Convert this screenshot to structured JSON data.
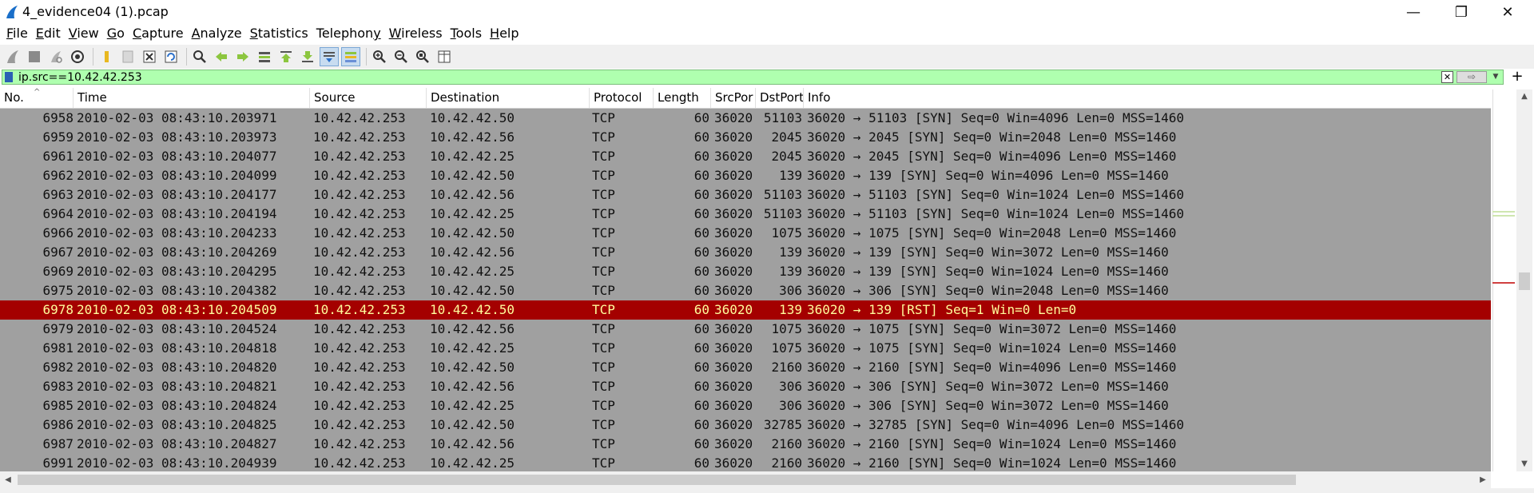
{
  "window": {
    "title": "4_evidence04 (1).pcap",
    "minimize": "—",
    "restore": "❐",
    "close": "✕"
  },
  "menu": [
    {
      "ul": "F",
      "rest": "ile"
    },
    {
      "ul": "E",
      "rest": "dit"
    },
    {
      "ul": "V",
      "rest": "iew"
    },
    {
      "ul": "G",
      "rest": "o"
    },
    {
      "ul": "C",
      "rest": "apture"
    },
    {
      "ul": "A",
      "rest": "nalyze"
    },
    {
      "ul": "S",
      "rest": "tatistics"
    },
    {
      "ul": "",
      "rest": "Telephon",
      "ul2": "y"
    },
    {
      "ul": "W",
      "rest": "ireless"
    },
    {
      "ul": "T",
      "rest": "ools"
    },
    {
      "ul": "H",
      "rest": "elp"
    }
  ],
  "filter": {
    "value": "ip.src==10.42.42.253",
    "clear": "✕",
    "apply": "⇨",
    "dropdown": "▼",
    "add": "+"
  },
  "columns": {
    "no": "No.",
    "time": "Time",
    "source": "Source",
    "destination": "Destination",
    "protocol": "Protocol",
    "length": "Length",
    "srcport": "SrcPor",
    "dstport": "DstPort",
    "info": "Info"
  },
  "packets": [
    {
      "no": "6958",
      "time": "2010-02-03 08:43:10.203971",
      "src": "10.42.42.253",
      "dst": "10.42.42.50",
      "proto": "TCP",
      "len": "60",
      "sport": "36020",
      "dport": "51103",
      "info": "36020 → 51103 [SYN] Seq=0 Win=4096 Len=0 MSS=1460"
    },
    {
      "no": "6959",
      "time": "2010-02-03 08:43:10.203973",
      "src": "10.42.42.253",
      "dst": "10.42.42.56",
      "proto": "TCP",
      "len": "60",
      "sport": "36020",
      "dport": "2045",
      "info": "36020 → 2045 [SYN] Seq=0 Win=2048 Len=0 MSS=1460"
    },
    {
      "no": "6961",
      "time": "2010-02-03 08:43:10.204077",
      "src": "10.42.42.253",
      "dst": "10.42.42.25",
      "proto": "TCP",
      "len": "60",
      "sport": "36020",
      "dport": "2045",
      "info": "36020 → 2045 [SYN] Seq=0 Win=4096 Len=0 MSS=1460"
    },
    {
      "no": "6962",
      "time": "2010-02-03 08:43:10.204099",
      "src": "10.42.42.253",
      "dst": "10.42.42.50",
      "proto": "TCP",
      "len": "60",
      "sport": "36020",
      "dport": "139",
      "info": "36020 → 139 [SYN] Seq=0 Win=4096 Len=0 MSS=1460"
    },
    {
      "no": "6963",
      "time": "2010-02-03 08:43:10.204177",
      "src": "10.42.42.253",
      "dst": "10.42.42.56",
      "proto": "TCP",
      "len": "60",
      "sport": "36020",
      "dport": "51103",
      "info": "36020 → 51103 [SYN] Seq=0 Win=1024 Len=0 MSS=1460"
    },
    {
      "no": "6964",
      "time": "2010-02-03 08:43:10.204194",
      "src": "10.42.42.253",
      "dst": "10.42.42.25",
      "proto": "TCP",
      "len": "60",
      "sport": "36020",
      "dport": "51103",
      "info": "36020 → 51103 [SYN] Seq=0 Win=1024 Len=0 MSS=1460"
    },
    {
      "no": "6966",
      "time": "2010-02-03 08:43:10.204233",
      "src": "10.42.42.253",
      "dst": "10.42.42.50",
      "proto": "TCP",
      "len": "60",
      "sport": "36020",
      "dport": "1075",
      "info": "36020 → 1075 [SYN] Seq=0 Win=2048 Len=0 MSS=1460"
    },
    {
      "no": "6967",
      "time": "2010-02-03 08:43:10.204269",
      "src": "10.42.42.253",
      "dst": "10.42.42.56",
      "proto": "TCP",
      "len": "60",
      "sport": "36020",
      "dport": "139",
      "info": "36020 → 139 [SYN] Seq=0 Win=3072 Len=0 MSS=1460"
    },
    {
      "no": "6969",
      "time": "2010-02-03 08:43:10.204295",
      "src": "10.42.42.253",
      "dst": "10.42.42.25",
      "proto": "TCP",
      "len": "60",
      "sport": "36020",
      "dport": "139",
      "info": "36020 → 139 [SYN] Seq=0 Win=1024 Len=0 MSS=1460"
    },
    {
      "no": "6975",
      "time": "2010-02-03 08:43:10.204382",
      "src": "10.42.42.253",
      "dst": "10.42.42.50",
      "proto": "TCP",
      "len": "60",
      "sport": "36020",
      "dport": "306",
      "info": "36020 → 306 [SYN] Seq=0 Win=2048 Len=0 MSS=1460"
    },
    {
      "no": "6978",
      "time": "2010-02-03 08:43:10.204509",
      "src": "10.42.42.253",
      "dst": "10.42.42.50",
      "proto": "TCP",
      "len": "60",
      "sport": "36020",
      "dport": "139",
      "info": "36020 → 139 [RST] Seq=1 Win=0 Len=0",
      "selected": true
    },
    {
      "no": "6979",
      "time": "2010-02-03 08:43:10.204524",
      "src": "10.42.42.253",
      "dst": "10.42.42.56",
      "proto": "TCP",
      "len": "60",
      "sport": "36020",
      "dport": "1075",
      "info": "36020 → 1075 [SYN] Seq=0 Win=3072 Len=0 MSS=1460"
    },
    {
      "no": "6981",
      "time": "2010-02-03 08:43:10.204818",
      "src": "10.42.42.253",
      "dst": "10.42.42.25",
      "proto": "TCP",
      "len": "60",
      "sport": "36020",
      "dport": "1075",
      "info": "36020 → 1075 [SYN] Seq=0 Win=1024 Len=0 MSS=1460"
    },
    {
      "no": "6982",
      "time": "2010-02-03 08:43:10.204820",
      "src": "10.42.42.253",
      "dst": "10.42.42.50",
      "proto": "TCP",
      "len": "60",
      "sport": "36020",
      "dport": "2160",
      "info": "36020 → 2160 [SYN] Seq=0 Win=4096 Len=0 MSS=1460"
    },
    {
      "no": "6983",
      "time": "2010-02-03 08:43:10.204821",
      "src": "10.42.42.253",
      "dst": "10.42.42.56",
      "proto": "TCP",
      "len": "60",
      "sport": "36020",
      "dport": "306",
      "info": "36020 → 306 [SYN] Seq=0 Win=3072 Len=0 MSS=1460"
    },
    {
      "no": "6985",
      "time": "2010-02-03 08:43:10.204824",
      "src": "10.42.42.253",
      "dst": "10.42.42.25",
      "proto": "TCP",
      "len": "60",
      "sport": "36020",
      "dport": "306",
      "info": "36020 → 306 [SYN] Seq=0 Win=3072 Len=0 MSS=1460"
    },
    {
      "no": "6986",
      "time": "2010-02-03 08:43:10.204825",
      "src": "10.42.42.253",
      "dst": "10.42.42.50",
      "proto": "TCP",
      "len": "60",
      "sport": "36020",
      "dport": "32785",
      "info": "36020 → 32785 [SYN] Seq=0 Win=4096 Len=0 MSS=1460"
    },
    {
      "no": "6987",
      "time": "2010-02-03 08:43:10.204827",
      "src": "10.42.42.253",
      "dst": "10.42.42.56",
      "proto": "TCP",
      "len": "60",
      "sport": "36020",
      "dport": "2160",
      "info": "36020 → 2160 [SYN] Seq=0 Win=1024 Len=0 MSS=1460"
    },
    {
      "no": "6991",
      "time": "2010-02-03 08:43:10.204939",
      "src": "10.42.42.253",
      "dst": "10.42.42.25",
      "proto": "TCP",
      "len": "60",
      "sport": "36020",
      "dport": "2160",
      "info": "36020 → 2160 [SYN] Seq=0 Win=1024 Len=0 MSS=1460"
    }
  ],
  "toolbar_icons": [
    "shark-fin-start-icon",
    "stop-icon",
    "restart-icon",
    "capture-options-icon",
    "open-folder-icon",
    "save-icon",
    "close-file-icon",
    "reload-icon",
    "find-packet-icon",
    "go-back-icon",
    "go-forward-icon",
    "go-to-packet-icon",
    "go-first-icon",
    "go-last-icon",
    "autoscroll-icon",
    "colorize-icon",
    "zoom-in-icon",
    "zoom-out-icon",
    "zoom-normal-icon",
    "resize-columns-icon"
  ],
  "scroll": {
    "up": "▲",
    "down": "▼",
    "left": "◀",
    "right": "▶"
  },
  "colors": {
    "selected_bg": "#a40000",
    "selected_fg": "#fffc9c",
    "row_bg": "#a0a0a0",
    "filter_bg": "#afffaf"
  }
}
